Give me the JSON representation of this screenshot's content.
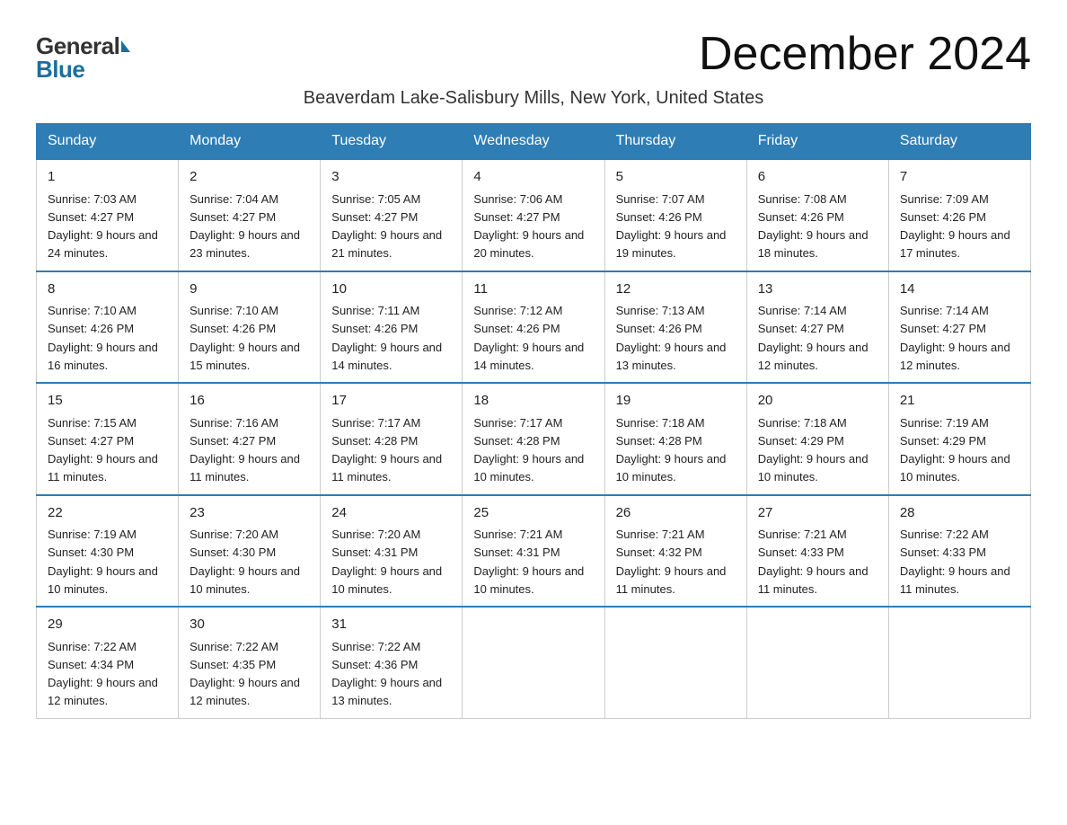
{
  "logo": {
    "general": "General",
    "blue": "Blue"
  },
  "title": "December 2024",
  "subtitle": "Beaverdam Lake-Salisbury Mills, New York, United States",
  "days_of_week": [
    "Sunday",
    "Monday",
    "Tuesday",
    "Wednesday",
    "Thursday",
    "Friday",
    "Saturday"
  ],
  "weeks": [
    [
      {
        "day": "1",
        "sunrise": "7:03 AM",
        "sunset": "4:27 PM",
        "daylight": "9 hours and 24 minutes."
      },
      {
        "day": "2",
        "sunrise": "7:04 AM",
        "sunset": "4:27 PM",
        "daylight": "9 hours and 23 minutes."
      },
      {
        "day": "3",
        "sunrise": "7:05 AM",
        "sunset": "4:27 PM",
        "daylight": "9 hours and 21 minutes."
      },
      {
        "day": "4",
        "sunrise": "7:06 AM",
        "sunset": "4:27 PM",
        "daylight": "9 hours and 20 minutes."
      },
      {
        "day": "5",
        "sunrise": "7:07 AM",
        "sunset": "4:26 PM",
        "daylight": "9 hours and 19 minutes."
      },
      {
        "day": "6",
        "sunrise": "7:08 AM",
        "sunset": "4:26 PM",
        "daylight": "9 hours and 18 minutes."
      },
      {
        "day": "7",
        "sunrise": "7:09 AM",
        "sunset": "4:26 PM",
        "daylight": "9 hours and 17 minutes."
      }
    ],
    [
      {
        "day": "8",
        "sunrise": "7:10 AM",
        "sunset": "4:26 PM",
        "daylight": "9 hours and 16 minutes."
      },
      {
        "day": "9",
        "sunrise": "7:10 AM",
        "sunset": "4:26 PM",
        "daylight": "9 hours and 15 minutes."
      },
      {
        "day": "10",
        "sunrise": "7:11 AM",
        "sunset": "4:26 PM",
        "daylight": "9 hours and 14 minutes."
      },
      {
        "day": "11",
        "sunrise": "7:12 AM",
        "sunset": "4:26 PM",
        "daylight": "9 hours and 14 minutes."
      },
      {
        "day": "12",
        "sunrise": "7:13 AM",
        "sunset": "4:26 PM",
        "daylight": "9 hours and 13 minutes."
      },
      {
        "day": "13",
        "sunrise": "7:14 AM",
        "sunset": "4:27 PM",
        "daylight": "9 hours and 12 minutes."
      },
      {
        "day": "14",
        "sunrise": "7:14 AM",
        "sunset": "4:27 PM",
        "daylight": "9 hours and 12 minutes."
      }
    ],
    [
      {
        "day": "15",
        "sunrise": "7:15 AM",
        "sunset": "4:27 PM",
        "daylight": "9 hours and 11 minutes."
      },
      {
        "day": "16",
        "sunrise": "7:16 AM",
        "sunset": "4:27 PM",
        "daylight": "9 hours and 11 minutes."
      },
      {
        "day": "17",
        "sunrise": "7:17 AM",
        "sunset": "4:28 PM",
        "daylight": "9 hours and 11 minutes."
      },
      {
        "day": "18",
        "sunrise": "7:17 AM",
        "sunset": "4:28 PM",
        "daylight": "9 hours and 10 minutes."
      },
      {
        "day": "19",
        "sunrise": "7:18 AM",
        "sunset": "4:28 PM",
        "daylight": "9 hours and 10 minutes."
      },
      {
        "day": "20",
        "sunrise": "7:18 AM",
        "sunset": "4:29 PM",
        "daylight": "9 hours and 10 minutes."
      },
      {
        "day": "21",
        "sunrise": "7:19 AM",
        "sunset": "4:29 PM",
        "daylight": "9 hours and 10 minutes."
      }
    ],
    [
      {
        "day": "22",
        "sunrise": "7:19 AM",
        "sunset": "4:30 PM",
        "daylight": "9 hours and 10 minutes."
      },
      {
        "day": "23",
        "sunrise": "7:20 AM",
        "sunset": "4:30 PM",
        "daylight": "9 hours and 10 minutes."
      },
      {
        "day": "24",
        "sunrise": "7:20 AM",
        "sunset": "4:31 PM",
        "daylight": "9 hours and 10 minutes."
      },
      {
        "day": "25",
        "sunrise": "7:21 AM",
        "sunset": "4:31 PM",
        "daylight": "9 hours and 10 minutes."
      },
      {
        "day": "26",
        "sunrise": "7:21 AM",
        "sunset": "4:32 PM",
        "daylight": "9 hours and 11 minutes."
      },
      {
        "day": "27",
        "sunrise": "7:21 AM",
        "sunset": "4:33 PM",
        "daylight": "9 hours and 11 minutes."
      },
      {
        "day": "28",
        "sunrise": "7:22 AM",
        "sunset": "4:33 PM",
        "daylight": "9 hours and 11 minutes."
      }
    ],
    [
      {
        "day": "29",
        "sunrise": "7:22 AM",
        "sunset": "4:34 PM",
        "daylight": "9 hours and 12 minutes."
      },
      {
        "day": "30",
        "sunrise": "7:22 AM",
        "sunset": "4:35 PM",
        "daylight": "9 hours and 12 minutes."
      },
      {
        "day": "31",
        "sunrise": "7:22 AM",
        "sunset": "4:36 PM",
        "daylight": "9 hours and 13 minutes."
      },
      null,
      null,
      null,
      null
    ]
  ]
}
